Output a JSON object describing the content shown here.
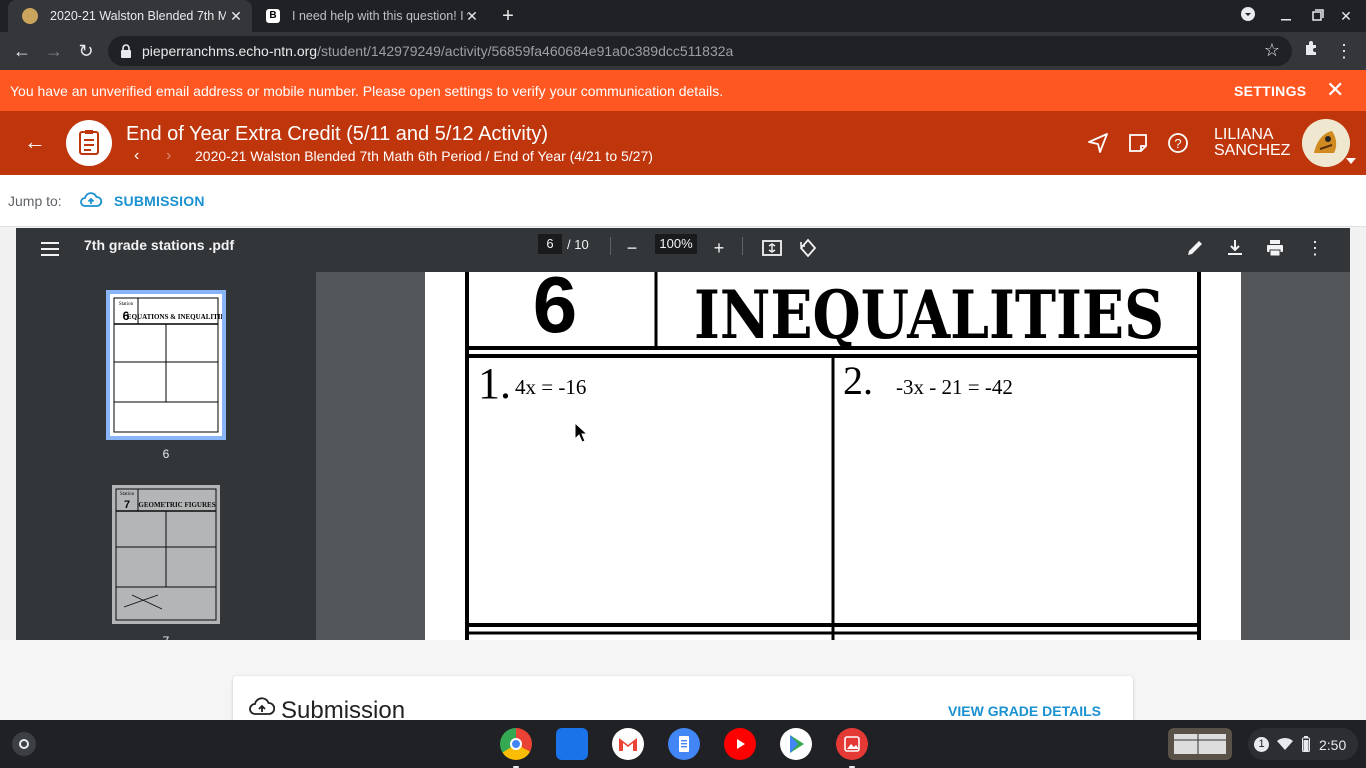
{
  "browser": {
    "tabs": [
      {
        "title": "2020-21 Walston Blended 7th M",
        "active": true
      },
      {
        "title": "I need help with this question! I w",
        "active": false
      }
    ],
    "url_host": "pieperranchms.echo-ntn.org",
    "url_path": "/student/142979249/activity/56859fa460684e91a0c389dcc511832a"
  },
  "notice": {
    "message": "You have an unverified email address or mobile number. Please open settings to verify your communication details.",
    "settings_label": "SETTINGS",
    "color": "#ff5722"
  },
  "activity": {
    "title": "End of Year Extra Credit (5/11 and 5/12 Activity)",
    "breadcrumb": "2020-21 Walston Blended 7th Math 6th Period / End of Year (4/21 to 5/27)",
    "user_first": "LILIANA",
    "user_last": "SANCHEZ",
    "color": "#bf360c"
  },
  "jump": {
    "label": "Jump to:",
    "link": "SUBMISSION"
  },
  "pdf": {
    "filename": "7th grade stations .pdf",
    "current_page": "6",
    "total_pages": "/ 10",
    "zoom": "100%",
    "thumbnails": [
      {
        "label": "6",
        "station_word": "Station",
        "station_num": "6",
        "heading": "EQUATIONS & INEQUALITIES"
      },
      {
        "label": "7",
        "station_word": "Station",
        "station_num": "7",
        "heading": "GEOMETRIC FIGURES"
      }
    ],
    "page_content": {
      "station_num": "6",
      "heading": "INEQUALITIES",
      "problem1_num": "1.",
      "problem1": "4x = -16",
      "problem2_num": "2.",
      "problem2": "-3x - 21 = -42"
    }
  },
  "submission": {
    "heading": "Submission",
    "view_grade": "VIEW GRADE DETAILS"
  },
  "shelf": {
    "apps": [
      "chrome-icon",
      "files-icon",
      "gmail-icon",
      "docs-icon",
      "youtube-icon",
      "play-store-icon",
      "gallery-icon"
    ],
    "notification_count": "1",
    "time": "2:50"
  }
}
